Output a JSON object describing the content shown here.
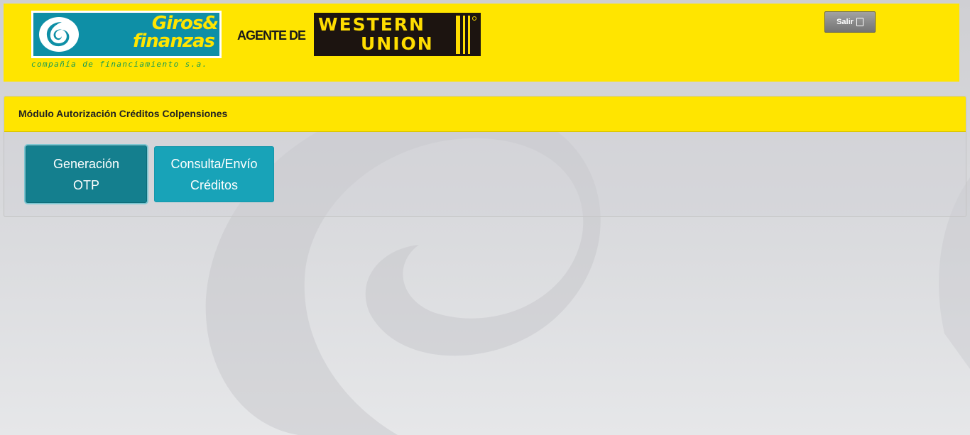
{
  "header": {
    "logo": {
      "line1": "Giros&",
      "line2": "finanzas",
      "tagline": "compañía de financiamiento s.a."
    },
    "agent_label": "AGENTE DE",
    "western_union": {
      "line1": "WESTERN",
      "line2": "UNION"
    },
    "logout": {
      "label": "Salir",
      "icon": "exit-icon"
    }
  },
  "panel": {
    "title": "Módulo Autorización Créditos Colpensiones",
    "buttons": [
      {
        "line1": "Generación",
        "line2": "OTP",
        "active": true
      },
      {
        "line1": "Consulta/Envío",
        "line2": "Créditos",
        "active": false
      }
    ]
  },
  "colors": {
    "brand_yellow": "#ffe500",
    "logo_teal": "#0e8fa6",
    "button_active": "#147f8e",
    "button_default": "#18a3b8"
  }
}
